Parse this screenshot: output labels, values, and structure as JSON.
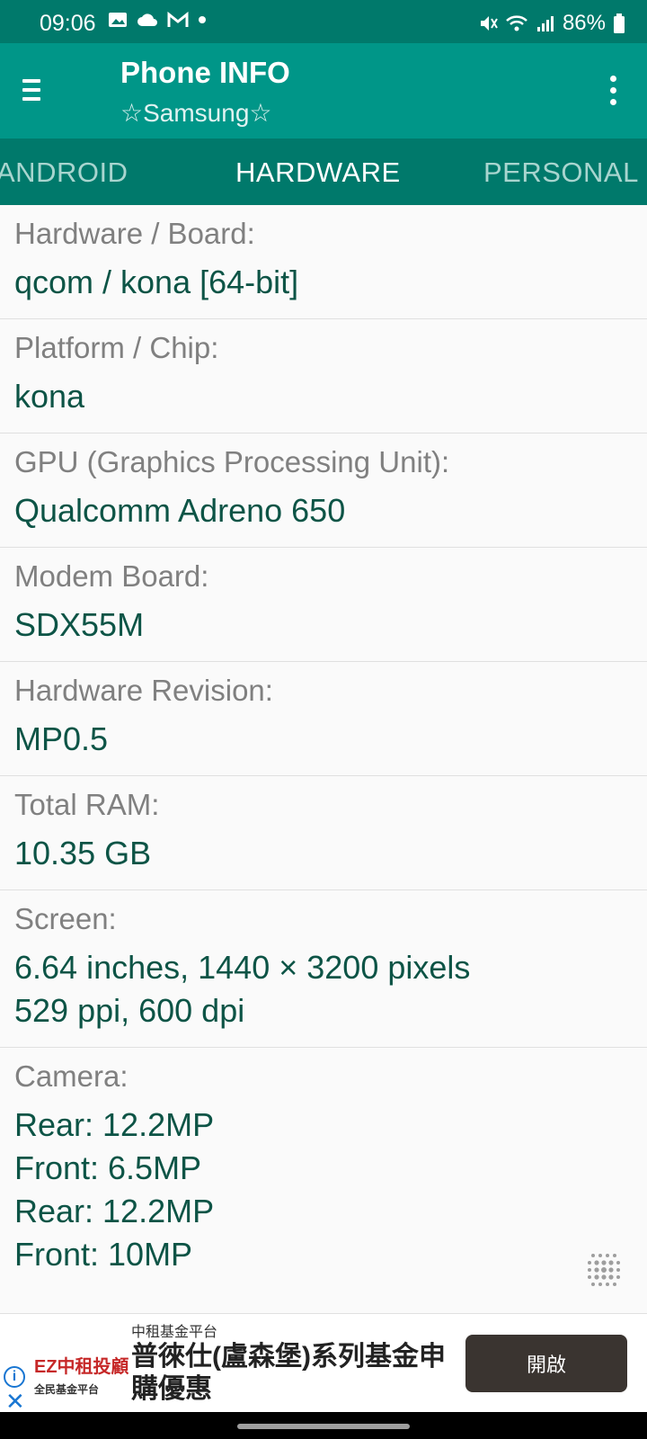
{
  "status_bar": {
    "time": "09:06",
    "battery": "86%",
    "notification_icons": [
      "image-icon",
      "cloud-icon",
      "gmail-icon",
      "dot-icon"
    ],
    "system_icons": [
      "mute-icon",
      "wifi-icon",
      "signal-icon",
      "battery-icon"
    ]
  },
  "app_bar": {
    "title": "Phone INFO",
    "subtitle": "☆Samsung☆",
    "menu_icon": "hamburger-icon",
    "overflow_icon": "more-vert-icon",
    "color": "#009688"
  },
  "tabs": [
    {
      "label": "ANDROID",
      "active": false
    },
    {
      "label": "HARDWARE",
      "active": true
    },
    {
      "label": "PERSONAL",
      "active": false
    }
  ],
  "items": [
    {
      "label": "Hardware / Board:",
      "value": "qcom / kona [64-bit]"
    },
    {
      "label": "Platform / Chip:",
      "value": "kona"
    },
    {
      "label": "GPU (Graphics Processing Unit):",
      "value": "Qualcomm Adreno 650"
    },
    {
      "label": "Modem Board:",
      "value": "SDX55M"
    },
    {
      "label": "Hardware Revision:",
      "value": "MP0.5"
    },
    {
      "label": "Total RAM:",
      "value": "10.35 GB"
    },
    {
      "label": "Screen:",
      "value": "6.64 inches, 1440 × 3200 pixels\n529 ppi, 600 dpi"
    },
    {
      "label": "Camera:",
      "value": "Rear: 12.2MP\nFront: 6.5MP\nRear: 12.2MP\nFront: 10MP"
    }
  ],
  "ad": {
    "logo_main": "EZ中租投顧",
    "logo_sub": "全民基金平台",
    "small_title": "中租基金平台",
    "headline": "普徠仕(盧森堡)系列基金申購優惠",
    "cta": "開啟",
    "info_icon": "info-icon",
    "close_icon": "close-icon"
  },
  "colors": {
    "accent": "#009688",
    "accent_dark": "#00796b",
    "value_text": "#0d5446",
    "label_text": "#808080"
  }
}
